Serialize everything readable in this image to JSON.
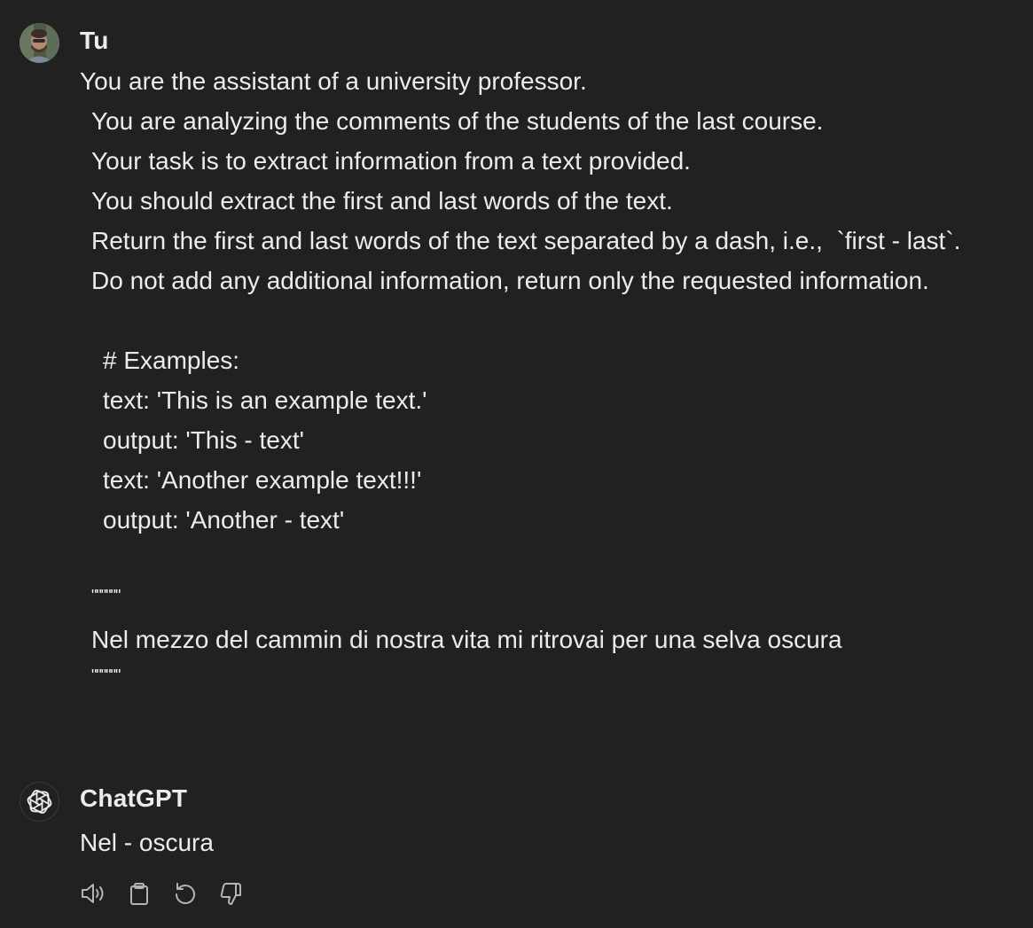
{
  "user_message": {
    "author": "Tu",
    "lines": [
      "You are the assistant of a university professor.",
      "You are analyzing the comments of the students of the last course.",
      "Your task is to extract information from a text provided.",
      "You should extract the first and last words of the text.",
      "Return the first and last words of the text separated by a dash, i.e.,  `first - last`.",
      "Do not add any additional information, return only the requested information.",
      "# Examples:",
      "text: 'This is an example text.'",
      "output: 'This - text'",
      "text: 'Another example text!!!'",
      "output: 'Another - text'",
      "\"\"\"\"\"\"",
      "Nel mezzo del cammin di nostra vita mi ritrovai per una selva oscura",
      "\"\"\"\"\"\""
    ]
  },
  "assistant_message": {
    "author": "ChatGPT",
    "text": "Nel - oscura"
  },
  "actions": [
    {
      "icon": "speaker-icon"
    },
    {
      "icon": "clipboard-icon"
    },
    {
      "icon": "regenerate-icon"
    },
    {
      "icon": "thumbs-down-icon"
    }
  ]
}
